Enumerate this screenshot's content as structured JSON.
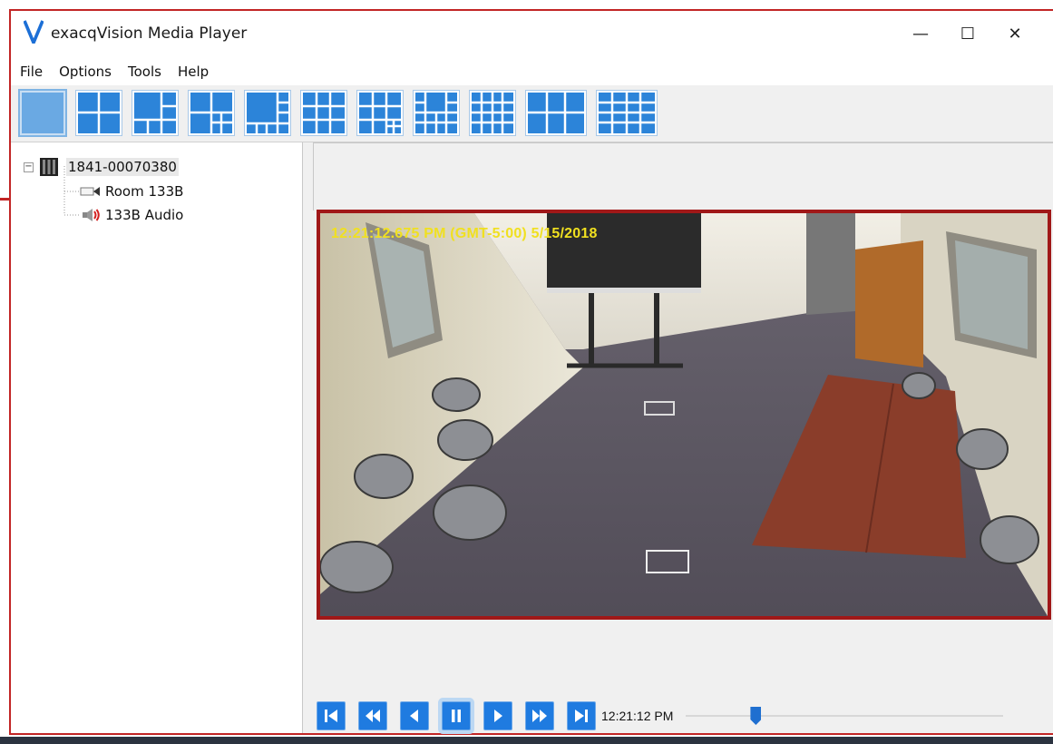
{
  "window": {
    "title": "exacqVision Media Player",
    "controls": {
      "minimize": "—",
      "maximize": "☐",
      "close": "✕"
    }
  },
  "menu": [
    "File",
    "Options",
    "Tools",
    "Help"
  ],
  "layout_buttons": [
    {
      "name": "layout-1x1",
      "active": true
    },
    {
      "name": "layout-2x2"
    },
    {
      "name": "layout-1plus3"
    },
    {
      "name": "layout-1plus5"
    },
    {
      "name": "layout-1plus7"
    },
    {
      "name": "layout-3x3"
    },
    {
      "name": "layout-1plus9"
    },
    {
      "name": "layout-1plus12"
    },
    {
      "name": "layout-4x4"
    },
    {
      "name": "layout-2x3-wide"
    },
    {
      "name": "layout-4x4-alt"
    }
  ],
  "tree": {
    "server": "1841-00070380",
    "camera": "Room 133B",
    "audio": "133B Audio"
  },
  "video": {
    "timestamp": "12:21:12.675 PM  (GMT-5:00) 5/15/2018"
  },
  "playback": {
    "buttons": [
      "skip-to-start",
      "rewind",
      "step-back",
      "pause",
      "play",
      "fast-forward",
      "skip-to-end"
    ],
    "active": "pause",
    "time": "12:21:12 PM",
    "position_fraction": 0.21
  },
  "colors": {
    "accent": "#1f7be0",
    "highlight_border": "#c22525",
    "timestamp": "#f0e020"
  }
}
